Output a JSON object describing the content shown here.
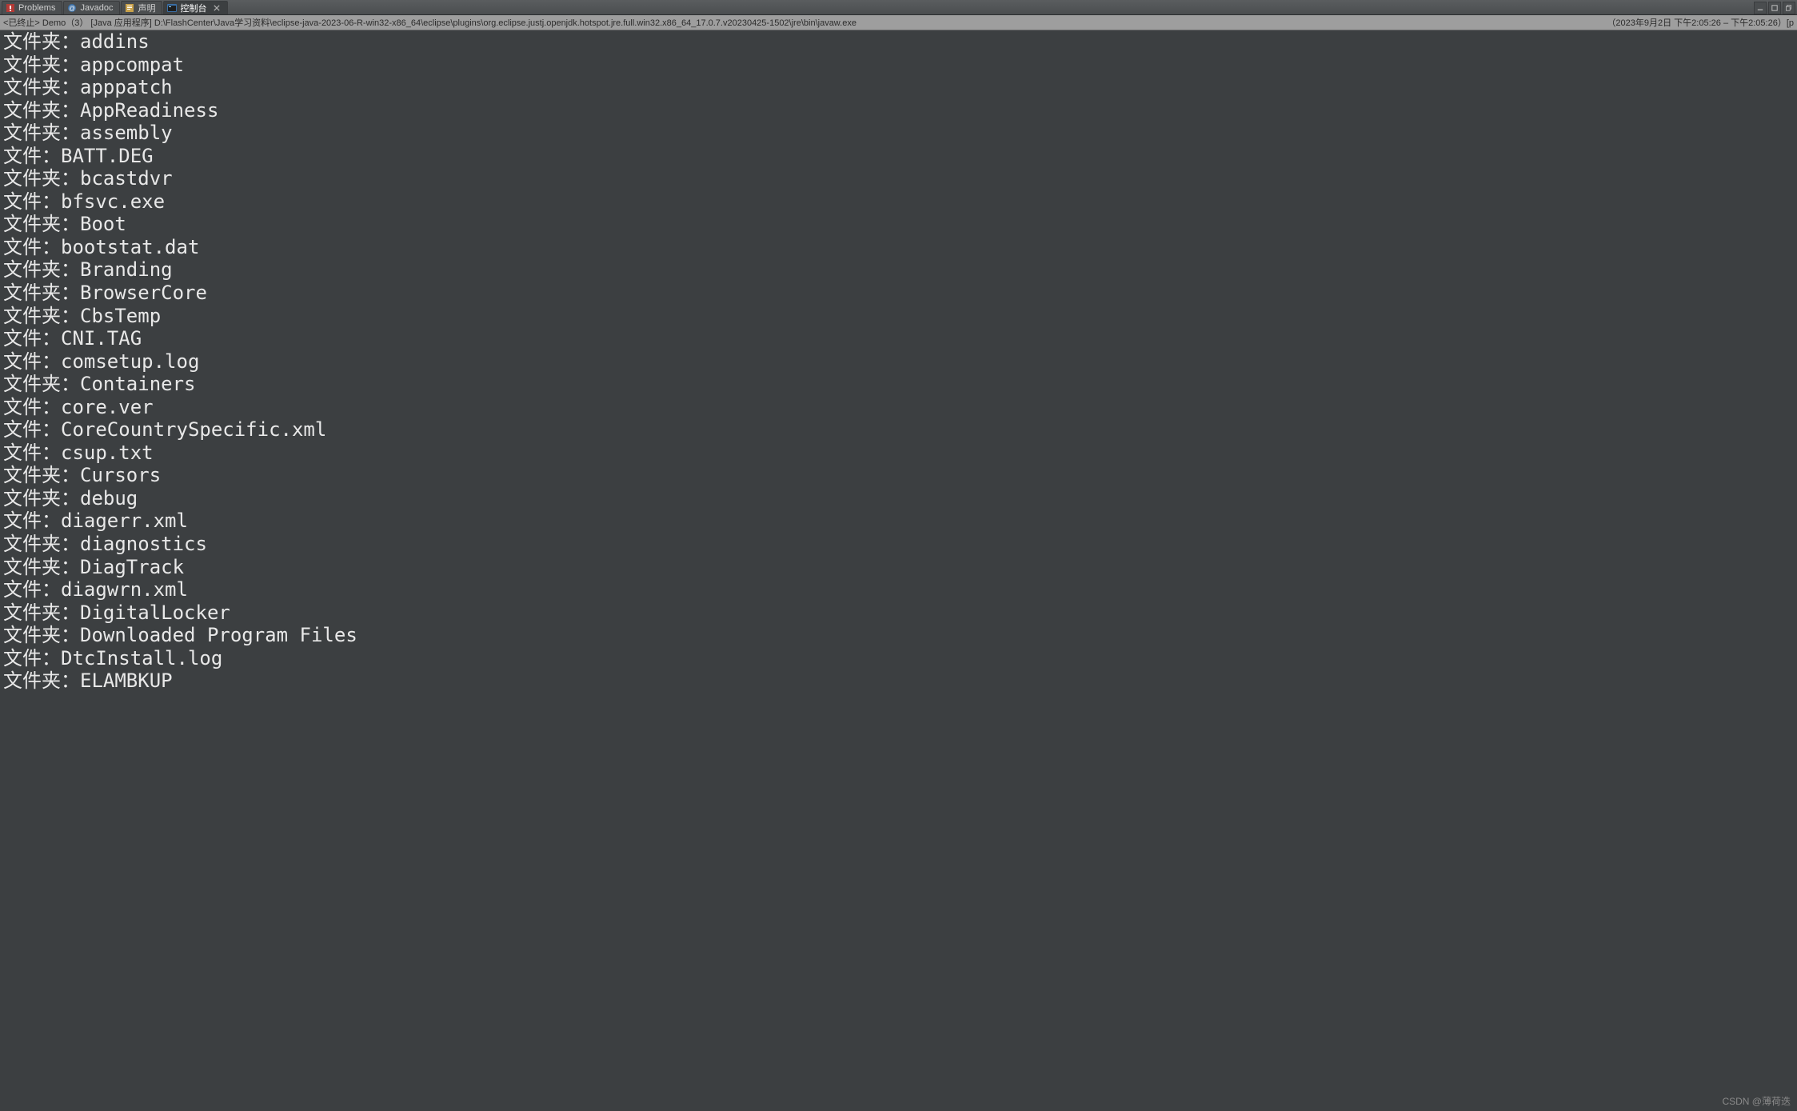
{
  "tabs": [
    {
      "label": "Problems",
      "icon": "problems-icon",
      "active": false
    },
    {
      "label": "Javadoc",
      "icon": "javadoc-icon",
      "active": false
    },
    {
      "label": "声明",
      "icon": "declaration-icon",
      "active": false
    },
    {
      "label": "控制台",
      "icon": "console-icon",
      "active": true
    }
  ],
  "status": {
    "left": "<已终止> Demo（3） [Java 应用程序] D:\\FlashCenter\\Java学习资料\\eclipse-java-2023-06-R-win32-x86_64\\eclipse\\plugins\\org.eclipse.justj.openjdk.hotspot.jre.full.win32.x86_64_17.0.7.v20230425-1502\\jre\\bin\\javaw.exe",
    "right": "（2023年9月2日 下午2:05:26 – 下午2:05:26）[p"
  },
  "labels": {
    "folder": "文件夹：",
    "file": "文件："
  },
  "entries": [
    {
      "type": "folder",
      "name": "addins"
    },
    {
      "type": "folder",
      "name": "appcompat"
    },
    {
      "type": "folder",
      "name": "apppatch"
    },
    {
      "type": "folder",
      "name": "AppReadiness"
    },
    {
      "type": "folder",
      "name": "assembly"
    },
    {
      "type": "file",
      "name": "BATT.DEG"
    },
    {
      "type": "folder",
      "name": "bcastdvr"
    },
    {
      "type": "file",
      "name": "bfsvc.exe"
    },
    {
      "type": "folder",
      "name": "Boot"
    },
    {
      "type": "file",
      "name": "bootstat.dat"
    },
    {
      "type": "folder",
      "name": "Branding"
    },
    {
      "type": "folder",
      "name": "BrowserCore"
    },
    {
      "type": "folder",
      "name": "CbsTemp"
    },
    {
      "type": "file",
      "name": "CNI.TAG"
    },
    {
      "type": "file",
      "name": "comsetup.log"
    },
    {
      "type": "folder",
      "name": "Containers"
    },
    {
      "type": "file",
      "name": "core.ver"
    },
    {
      "type": "file",
      "name": "CoreCountrySpecific.xml"
    },
    {
      "type": "file",
      "name": "csup.txt"
    },
    {
      "type": "folder",
      "name": "Cursors"
    },
    {
      "type": "folder",
      "name": "debug"
    },
    {
      "type": "file",
      "name": "diagerr.xml"
    },
    {
      "type": "folder",
      "name": "diagnostics"
    },
    {
      "type": "folder",
      "name": "DiagTrack"
    },
    {
      "type": "file",
      "name": "diagwrn.xml"
    },
    {
      "type": "folder",
      "name": "DigitalLocker"
    },
    {
      "type": "folder",
      "name": "Downloaded Program Files"
    },
    {
      "type": "file",
      "name": "DtcInstall.log"
    },
    {
      "type": "folder",
      "name": "ELAMBKUP"
    }
  ],
  "watermark": "CSDN @薄荷迭"
}
